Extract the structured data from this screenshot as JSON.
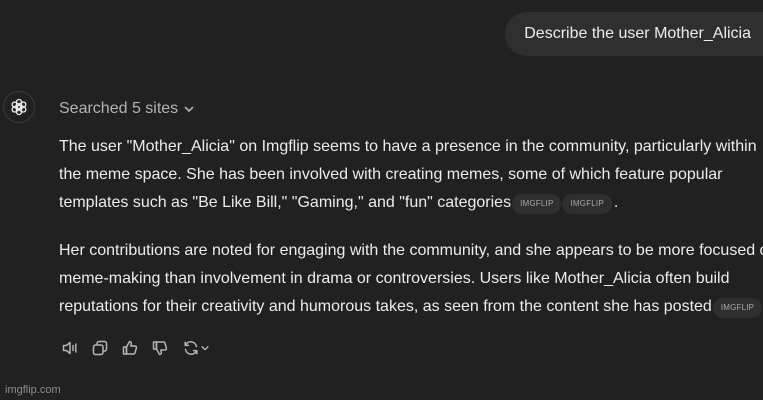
{
  "user_message": "Describe the user Mother_Alicia",
  "assistant": {
    "avatar_icon": "openai-logo-icon",
    "searched_label": "Searched 5 sites",
    "paragraphs": [
      {
        "lines": [
          "The user \"Mother_Alicia\" on Imgflip seems to have a presence in the community, particularly within",
          "the meme space. She has been involved with creating memes, some of which feature popular",
          "templates such as \"Be Like Bill,\" \"Gaming,\" and \"fun\" categories"
        ],
        "citations": [
          "IMGFLIP",
          "IMGFLIP"
        ],
        "end": "."
      },
      {
        "lines": [
          "Her contributions are noted for engaging with the community, and she appears to be more focused on",
          "meme-making than involvement in drama or controversies. Users like Mother_Alicia often build",
          "reputations for their creativity and humorous takes, as seen from the content she has posted"
        ],
        "citations": [
          "IMGFLIP"
        ],
        "end": "."
      }
    ],
    "actions": [
      "read-aloud-icon",
      "copy-icon",
      "thumbs-up-icon",
      "thumbs-down-icon",
      "regenerate-icon"
    ]
  },
  "watermark": "imgflip.com",
  "colors": {
    "background": "#212121",
    "bubble": "#2f2f2f",
    "text": "#ececec",
    "muted": "#b4b4b4"
  }
}
